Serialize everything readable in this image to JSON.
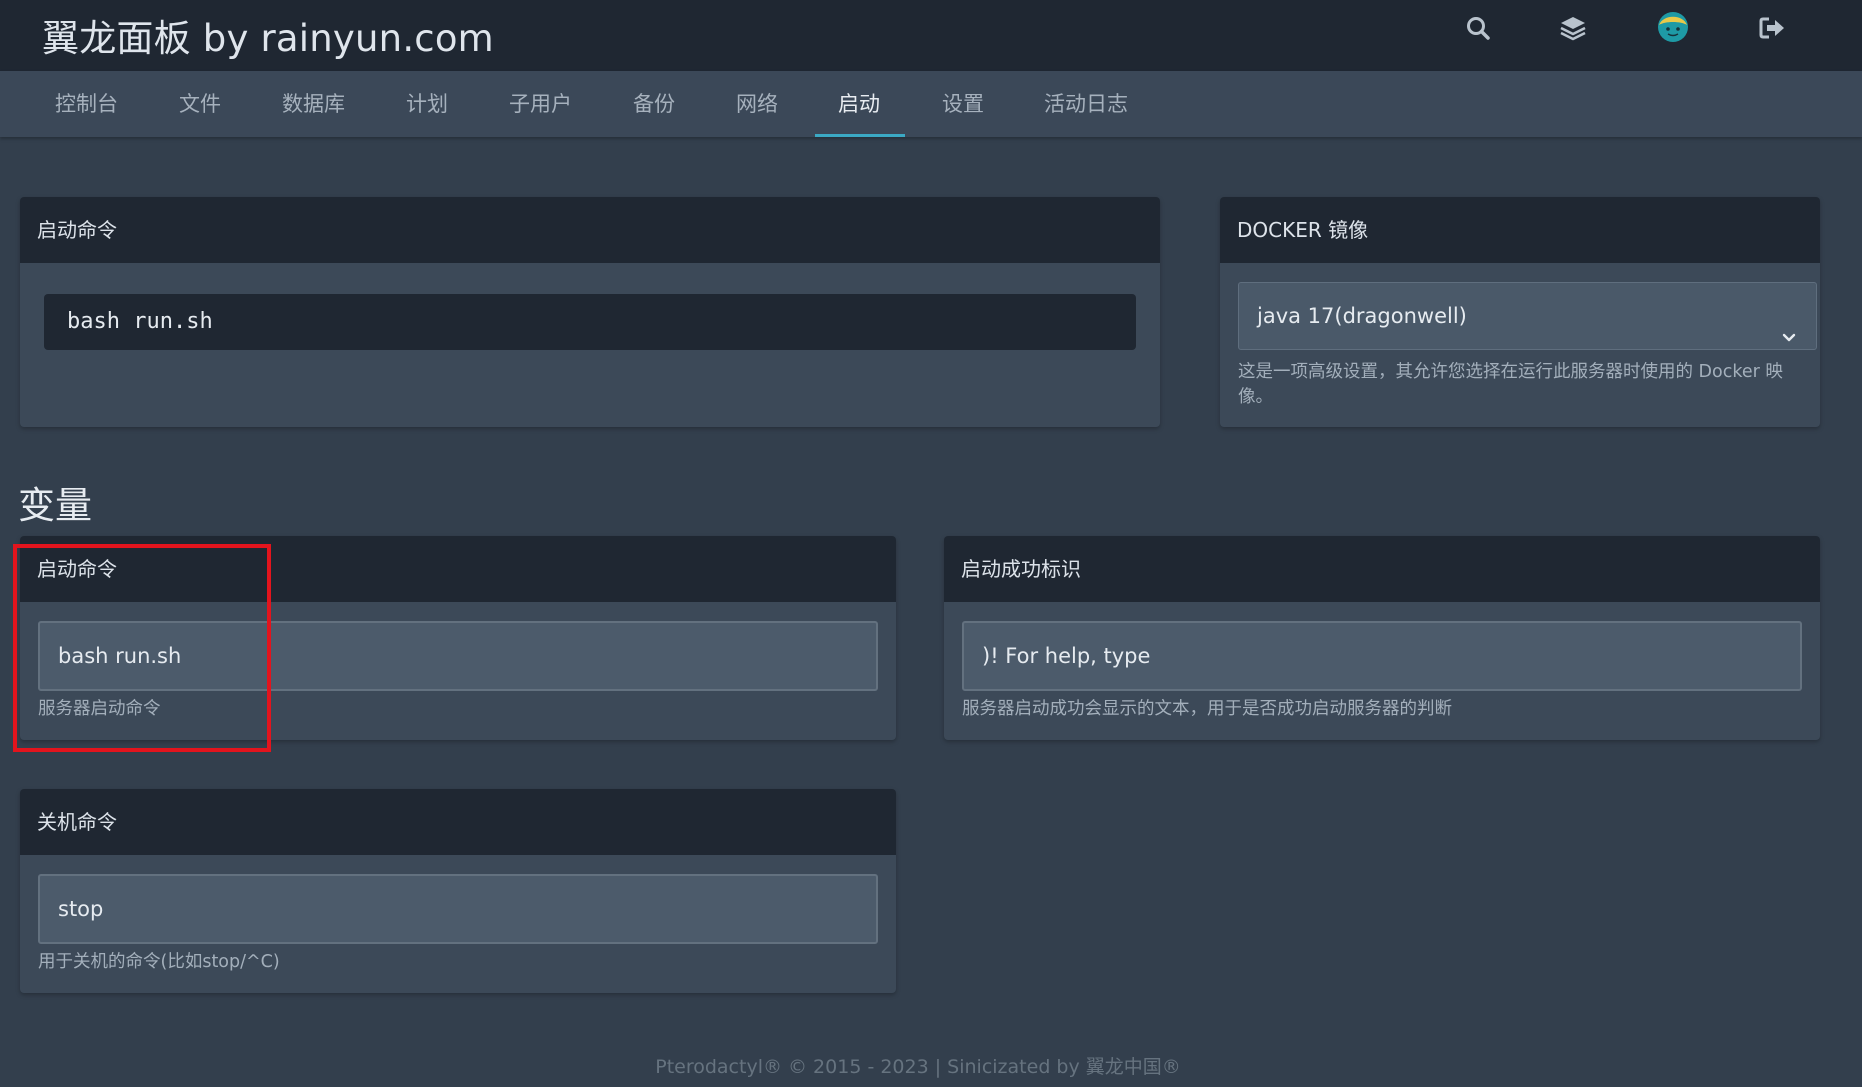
{
  "header": {
    "brand": "翼龙面板 by rainyun.com",
    "icons": [
      "search-icon",
      "layers-icon",
      "avatar",
      "logout-icon"
    ]
  },
  "nav": {
    "tabs": [
      {
        "label": "控制台"
      },
      {
        "label": "文件"
      },
      {
        "label": "数据库"
      },
      {
        "label": "计划"
      },
      {
        "label": "子用户"
      },
      {
        "label": "备份"
      },
      {
        "label": "网络"
      },
      {
        "label": "启动",
        "active": true
      },
      {
        "label": "设置"
      },
      {
        "label": "活动日志"
      }
    ]
  },
  "startup_card": {
    "title": "启动命令",
    "command": "bash run.sh"
  },
  "docker_card": {
    "title": "DOCKER 镜像",
    "selected": "java 17(dragonwell)",
    "help": "这是一项高级设置，其允许您选择在运行此服务器时使用的 Docker 映像。"
  },
  "variables": {
    "heading": "变量",
    "items": [
      {
        "title": "启动命令",
        "value": "bash run.sh",
        "help": "服务器启动命令"
      },
      {
        "title": "启动成功标识",
        "value": ")! For help, type",
        "help": "服务器启动成功会显示的文本，用于是否成功启动服务器的判断"
      },
      {
        "title": "关机命令",
        "value": "stop",
        "help": "用于关机的命令(比如stop/^C)"
      }
    ]
  },
  "footer": {
    "text": "Pterodactyl® © 2015 - 2023 | Sinicizated by 翼龙中国®"
  },
  "colors": {
    "background": "#333f4d",
    "header": "#1f2732",
    "accent": "#3ba9c4",
    "highlight_box": "#e3141d"
  }
}
